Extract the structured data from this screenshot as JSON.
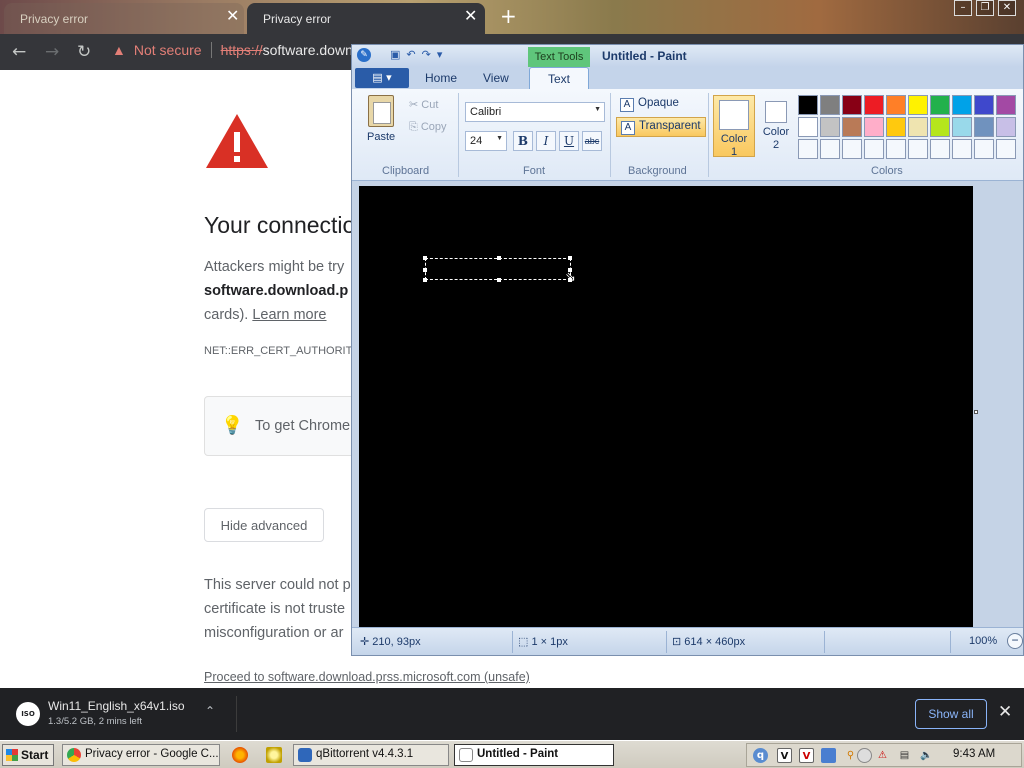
{
  "browser": {
    "tabs": [
      {
        "title": "Privacy error"
      },
      {
        "title": "Privacy error"
      }
    ],
    "omnibox": {
      "security": "Not secure",
      "scheme": "https://",
      "host": "software.down"
    },
    "page": {
      "heading": "Your connectio",
      "para1_line1": "Attackers might be try",
      "para1_line2": "software.download.p",
      "para1_line3_prefix": "cards). ",
      "learn_more": "Learn more",
      "error_code": "NET::ERR_CERT_AUTHORITY",
      "tip": "To get Chrome",
      "hide_advanced": "Hide advanced",
      "adv_line1": "This server could not p",
      "adv_line2": "certificate is not truste",
      "adv_line3": "misconfiguration or ar",
      "proceed": "Proceed to software.download.prss.microsoft.com (unsafe)"
    },
    "download_bar": {
      "file_name": "Win11_English_x64v1.iso",
      "status": "1.3/5.2 GB, 2 mins left",
      "icon_text": "ISO",
      "show_all": "Show all"
    }
  },
  "paint": {
    "context_tab": "Text Tools",
    "title": "Untitled - Paint",
    "tabs": {
      "home": "Home",
      "view": "View",
      "text": "Text"
    },
    "clipboard": {
      "paste": "Paste",
      "cut": "Cut",
      "copy": "Copy",
      "label": "Clipboard"
    },
    "font": {
      "family": "Calibri",
      "size": "24",
      "bold": "B",
      "italic": "I",
      "underline": "U",
      "strike": "abc",
      "label": "Font"
    },
    "background": {
      "opaque": "Opaque",
      "transparent": "Transparent",
      "label": "Background",
      "selected": "transparent"
    },
    "colors": {
      "color1_line1": "Color",
      "color1_line2": "1",
      "color2_line1": "Color",
      "color2_line2": "2",
      "label": "Colors",
      "color1_value": "#ffffff",
      "color2_value": "#ffffff",
      "palette": [
        "#000000",
        "#7f7f7f",
        "#880015",
        "#ed1c24",
        "#ff7f27",
        "#fff200",
        "#22b14c",
        "#00a2e8",
        "#3f48cc",
        "#a349a4",
        "#ffffff",
        "#c3c3c3",
        "#b97a57",
        "#ffaec9",
        "#ffc90e",
        "#efe4b0",
        "#b5e61d",
        "#99d9ea",
        "#7092be",
        "#c8bfe7",
        "#f4f8fd",
        "#f4f8fd",
        "#f4f8fd",
        "#f4f8fd",
        "#f4f8fd",
        "#f4f8fd",
        "#f4f8fd",
        "#f4f8fd",
        "#f4f8fd",
        "#f4f8fd"
      ]
    },
    "canvas_color": "#000000",
    "status": {
      "cursor_pos": "210, 93px",
      "selection_size": "1 × 1px",
      "image_size": "614 × 460px",
      "zoom": "100%"
    }
  },
  "taskbar": {
    "start": "Start",
    "tasks": [
      {
        "label": "Privacy error - Google C...",
        "active": false
      },
      {
        "label": "qBittorrent v4.4.3.1",
        "active": false
      },
      {
        "label": "Untitled - Paint",
        "active": true
      }
    ],
    "clock": "9:43 AM"
  }
}
